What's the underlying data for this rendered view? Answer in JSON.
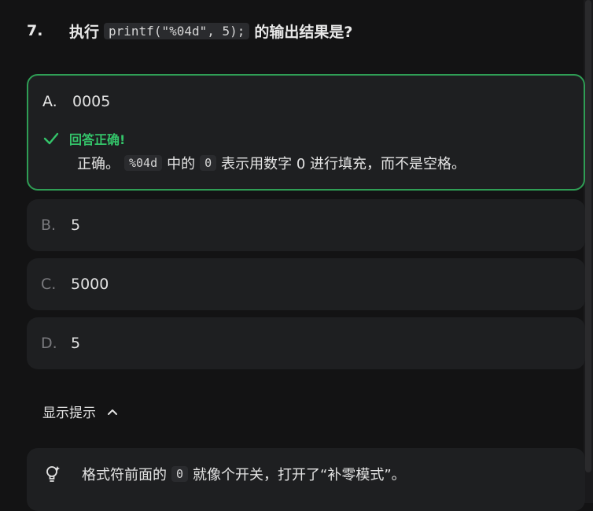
{
  "question": {
    "number": "7.",
    "prefix": "执行",
    "code": "printf(\"%04d\", 5);",
    "suffix": "的输出结果是?"
  },
  "options": [
    {
      "letter": "A.",
      "value": "0005",
      "selected": true,
      "correct": true
    },
    {
      "letter": "B.",
      "value": "5"
    },
    {
      "letter": "C.",
      "value": "5000"
    },
    {
      "letter": "D.",
      "value": "5"
    }
  ],
  "feedback": {
    "title": "回答正确!",
    "part1": "正确。",
    "code1": "%04d",
    "part2": "中的",
    "code2": "0",
    "part3": "表示用数字 0 进行填充，而不是空格。",
    "icon": "check-icon",
    "color": "#34c46a"
  },
  "hint": {
    "toggle_label": "显示提示",
    "toggle_icon": "chevron-up-icon",
    "part1": "格式符前面的",
    "code": "0",
    "part2": "就像个开关，打开了“补零模式”。",
    "icon": "lightbulb-icon"
  },
  "colors": {
    "background": "#131314",
    "card": "#1e1f21",
    "correct_border": "#2f9e55"
  }
}
